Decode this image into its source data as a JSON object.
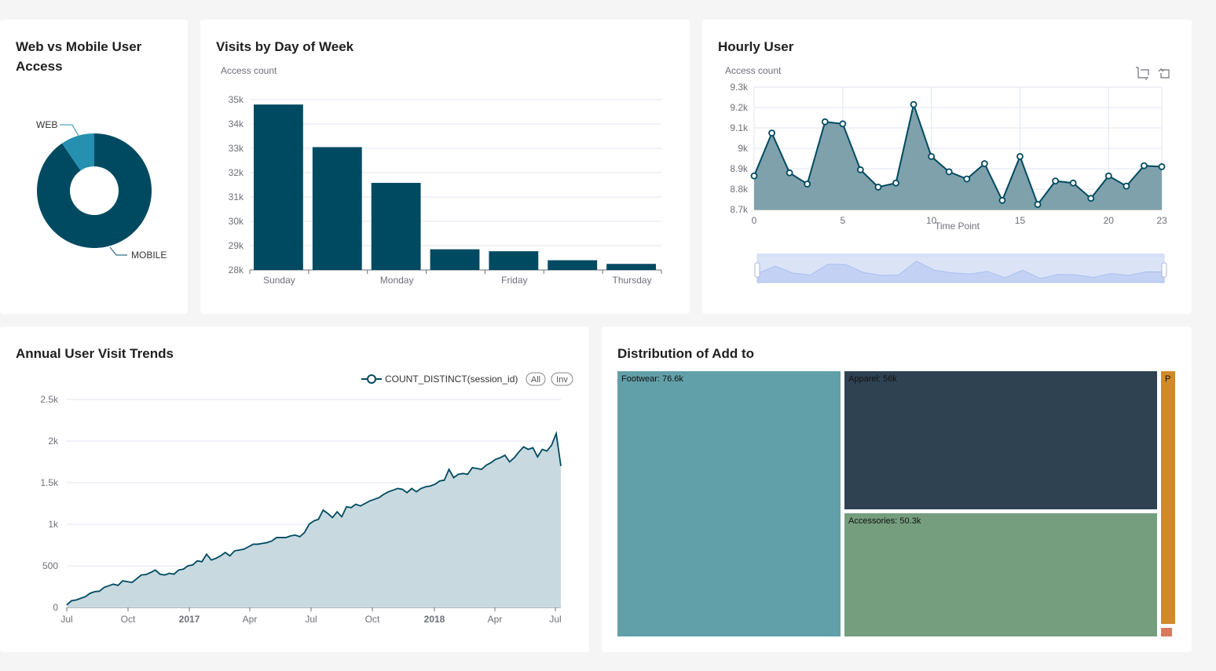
{
  "colors": {
    "primary": "#004a61",
    "secondary": "#2590b0",
    "area": "#c8dae0",
    "treemap": [
      "#62a0a9",
      "#2e4252",
      "#759e7e",
      "#d1892a",
      "#d97a5f"
    ]
  },
  "donut": {
    "title": "Web vs Mobile User Access",
    "chart_data": {
      "type": "pie",
      "slices": [
        {
          "name": "MOBILE",
          "value": 90.5
        },
        {
          "name": "WEB",
          "value": 9.5
        }
      ]
    }
  },
  "weekday": {
    "title": "Visits by Day of Week",
    "chart_data": {
      "type": "bar",
      "ylabel": "Access count",
      "ylim": [
        28000,
        35000
      ],
      "yticks": [
        "28k",
        "29k",
        "30k",
        "31k",
        "32k",
        "33k",
        "34k",
        "35k"
      ],
      "categories": [
        "Sunday",
        "",
        "Monday",
        "",
        "Friday",
        "",
        "Thursday"
      ],
      "values": [
        34800,
        33050,
        31580,
        28850,
        28770,
        28400,
        28250
      ]
    }
  },
  "hourly": {
    "title": "Hourly User",
    "chart_data": {
      "type": "area",
      "ylabel": "Access count",
      "xlabel": "Time Point",
      "ylim": [
        8700,
        9300
      ],
      "yticks": [
        "8.7k",
        "8.8k",
        "8.9k",
        "9k",
        "9.1k",
        "9.2k",
        "9.3k"
      ],
      "xticks": [
        "0",
        "5",
        "10",
        "15",
        "20",
        "23"
      ],
      "x": [
        0,
        1,
        2,
        3,
        4,
        5,
        6,
        7,
        8,
        9,
        10,
        11,
        12,
        13,
        14,
        15,
        16,
        17,
        18,
        19,
        20,
        21,
        22,
        23
      ],
      "values": [
        8865,
        9075,
        8880,
        8825,
        9130,
        9120,
        8895,
        8810,
        8830,
        9215,
        8960,
        8885,
        8850,
        8925,
        8745,
        8960,
        8725,
        8840,
        8830,
        8755,
        8865,
        8815,
        8915,
        8910
      ]
    }
  },
  "annual": {
    "title": "Annual User Visit Trends",
    "legend": {
      "series": "COUNT_DISTINCT(session_id)",
      "all": "All",
      "inv": "Inv"
    },
    "chart_data": {
      "type": "area",
      "ylim": [
        0,
        2500
      ],
      "yticks": [
        "0",
        "500",
        "1k",
        "1.5k",
        "2k",
        "2.5k"
      ],
      "xticks": [
        "Jul",
        "Oct",
        "2017",
        "Apr",
        "Jul",
        "Oct",
        "2018",
        "Apr",
        "Jul"
      ],
      "xrange": [
        "2016-07",
        "2018-07"
      ],
      "values": [
        30,
        80,
        90,
        110,
        130,
        170,
        190,
        195,
        240,
        260,
        280,
        265,
        320,
        310,
        300,
        345,
        390,
        395,
        420,
        450,
        400,
        390,
        410,
        400,
        450,
        460,
        500,
        510,
        560,
        550,
        640,
        570,
        590,
        620,
        660,
        620,
        680,
        690,
        700,
        730,
        760,
        760,
        770,
        780,
        800,
        840,
        840,
        840,
        860,
        870,
        850,
        900,
        1000,
        1040,
        1060,
        1170,
        1130,
        1080,
        1150,
        1090,
        1210,
        1200,
        1240,
        1220,
        1250,
        1280,
        1300,
        1320,
        1360,
        1390,
        1410,
        1430,
        1420,
        1380,
        1430,
        1390,
        1430,
        1450,
        1460,
        1480,
        1520,
        1530,
        1660,
        1560,
        1600,
        1610,
        1600,
        1680,
        1670,
        1660,
        1710,
        1740,
        1780,
        1800,
        1830,
        1750,
        1800,
        1870,
        1930,
        1900,
        1920,
        1810,
        1900,
        1880,
        1950,
        2090,
        1700
      ]
    }
  },
  "treemap": {
    "title": "Distribution of Add to",
    "chart_data": {
      "type": "treemap",
      "items": [
        {
          "name": "Footwear",
          "value": 76600,
          "label": "Footwear: 76.6k"
        },
        {
          "name": "Apparel",
          "value": 56000,
          "label": "Apparel: 56k"
        },
        {
          "name": "Accessories",
          "value": 50300,
          "label": "Accessories: 50.3k"
        },
        {
          "name": "P",
          "value": 5000,
          "label": "P"
        },
        {
          "name": "",
          "value": 300,
          "label": ""
        }
      ]
    }
  }
}
